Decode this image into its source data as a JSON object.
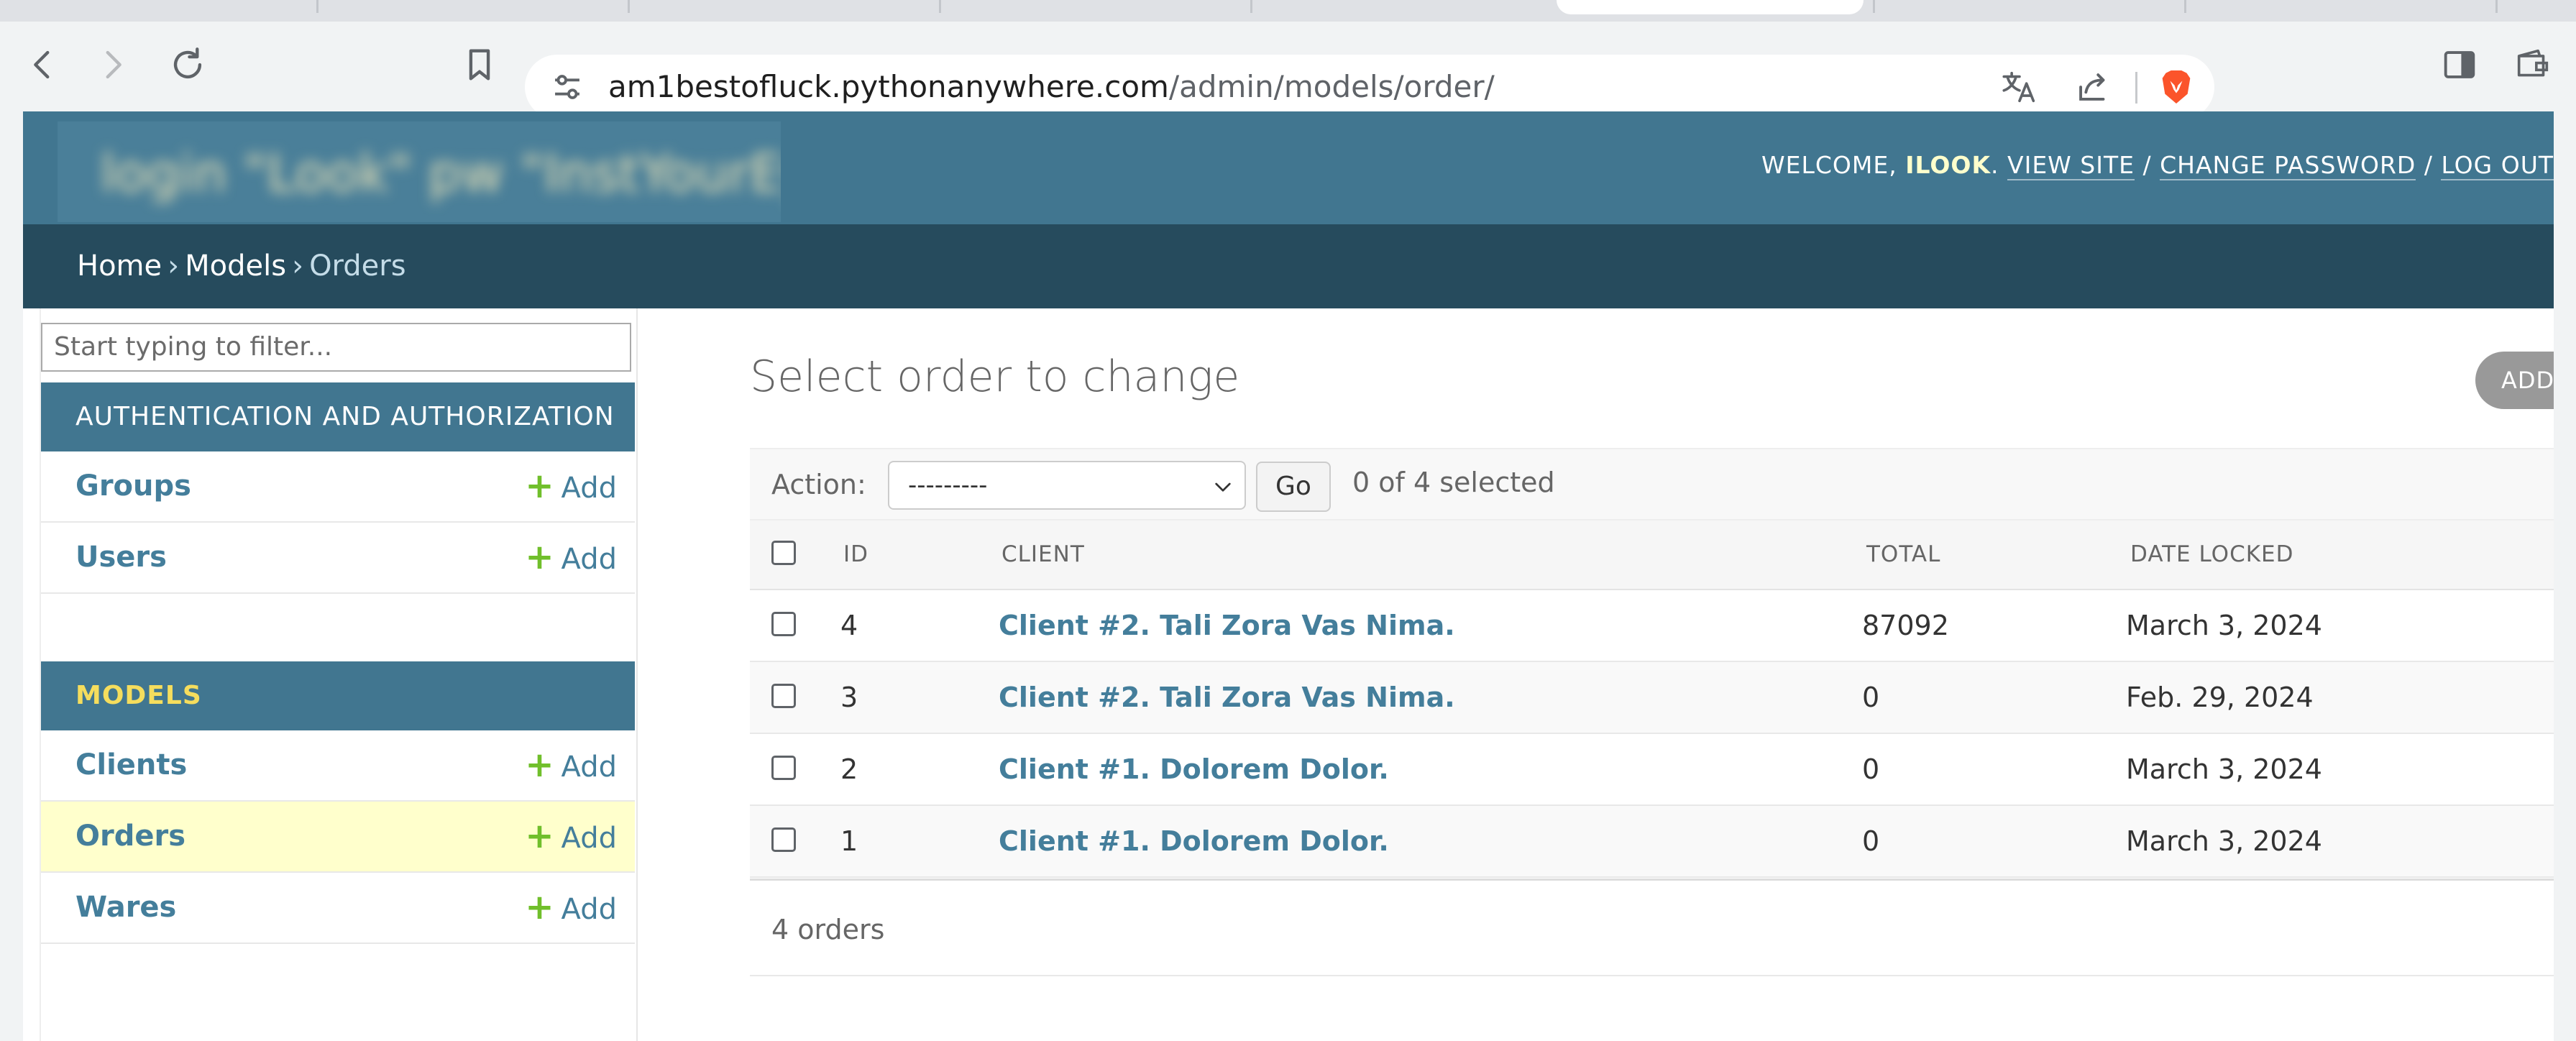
{
  "browser": {
    "url_host": "am1bestofluck.pythonanywhere.com",
    "url_path": "/admin/models/order/"
  },
  "header": {
    "branding_text": "login \"Look\" pw \"InstYourEyes\"",
    "welcome_prefix": "WELCOME,",
    "username": "ILOOK",
    "view_site": "VIEW SITE",
    "change_password": "CHANGE PASSWORD",
    "logout": "LOG OUT",
    "separator": "/"
  },
  "breadcrumbs": {
    "home": "Home",
    "models": "Models",
    "current": "Orders",
    "separator": "›"
  },
  "sidebar": {
    "filter_placeholder": "Start typing to filter...",
    "auth_caption": "AUTHENTICATION AND AUTHORIZATION",
    "auth_items": [
      {
        "label": "Groups",
        "add": "Add"
      },
      {
        "label": "Users",
        "add": "Add"
      }
    ],
    "models_caption": "MODELS",
    "models_items": [
      {
        "label": "Clients",
        "add": "Add"
      },
      {
        "label": "Orders",
        "add": "Add"
      },
      {
        "label": "Wares",
        "add": "Add"
      }
    ]
  },
  "content": {
    "title": "Select order to change",
    "add_button": "ADD ORDER +",
    "action_label": "Action:",
    "action_value": "---------",
    "go_button": "Go",
    "selected_counter": "0 of 4 selected",
    "columns": [
      "ID",
      "CLIENT",
      "TOTAL",
      "DATE LOCKED"
    ],
    "rows": [
      {
        "id": "4",
        "client": "Client #2. Tali Zora Vas Nima.",
        "total": "87092",
        "date": "March 3, 2024"
      },
      {
        "id": "3",
        "client": "Client #2. Tali Zora Vas Nima.",
        "total": "0",
        "date": "Feb. 29, 2024"
      },
      {
        "id": "2",
        "client": "Client #1. Dolorem Dolor.",
        "total": "0",
        "date": "March 3, 2024"
      },
      {
        "id": "1",
        "client": "Client #1. Dolorem Dolor.",
        "total": "0",
        "date": "March 3, 2024"
      }
    ],
    "paginator": "4 orders"
  },
  "colors": {
    "header": "#417690",
    "breadcrumbs": "#264b5d",
    "link": "#447e9b",
    "add_plus": "#70bf2b",
    "selected_row": "#ffffcc",
    "brave_orange": "#fb542b"
  },
  "icons": [
    "back-icon",
    "forward-icon",
    "reload-icon",
    "bookmark-icon",
    "site-settings-icon",
    "translate-icon",
    "share-icon",
    "brave-shield-icon",
    "sidebar-toggle-icon",
    "wallet-icon",
    "chevron-down-icon",
    "plus-icon"
  ]
}
